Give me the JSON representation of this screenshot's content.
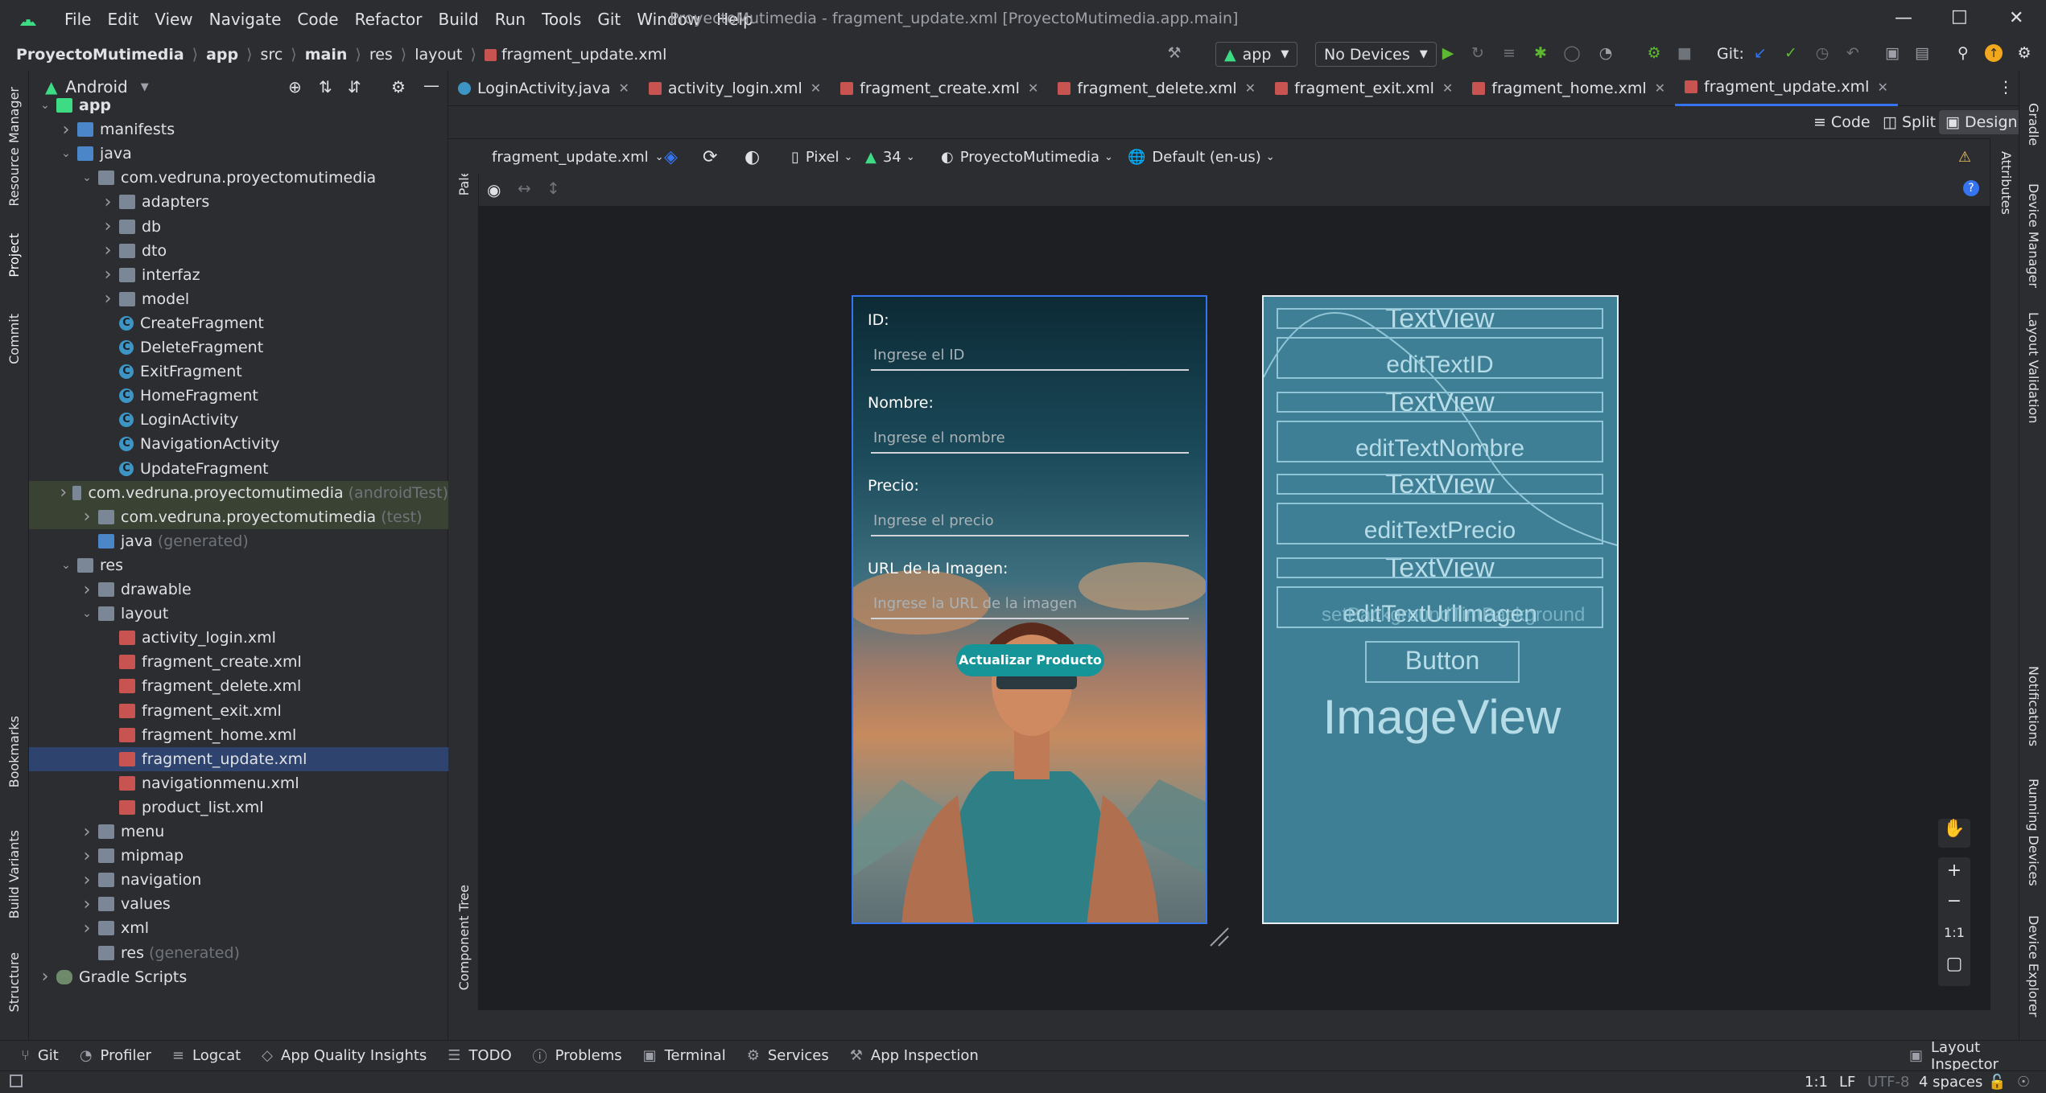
{
  "window": {
    "title": "ProyectoMutimedia - fragment_update.xml [ProyectoMutimedia.app.main]",
    "menu": [
      "File",
      "Edit",
      "View",
      "Navigate",
      "Code",
      "Refactor",
      "Build",
      "Run",
      "Tools",
      "Git",
      "Window",
      "Help"
    ]
  },
  "breadcrumb": [
    "ProyectoMutimedia",
    "app",
    "src",
    "main",
    "res",
    "layout",
    "fragment_update.xml"
  ],
  "toolbar": {
    "run_config": "app",
    "device": "No Devices",
    "git_label": "Git:"
  },
  "project": {
    "view_label": "Android",
    "tree": [
      {
        "label": "app",
        "level": 0,
        "type": "module",
        "bold": true,
        "open": true
      },
      {
        "label": "manifests",
        "level": 1,
        "type": "folder",
        "arrow": "closed"
      },
      {
        "label": "java",
        "level": 1,
        "type": "folder",
        "arrow": "open"
      },
      {
        "label": "com.vedruna.proyectomutimedia",
        "level": 2,
        "type": "folder",
        "arrow": "open"
      },
      {
        "label": "adapters",
        "level": 3,
        "type": "folder",
        "arrow": "closed"
      },
      {
        "label": "db",
        "level": 3,
        "type": "folder",
        "arrow": "closed"
      },
      {
        "label": "dto",
        "level": 3,
        "type": "folder",
        "arrow": "closed"
      },
      {
        "label": "interfaz",
        "level": 3,
        "type": "folder",
        "arrow": "closed"
      },
      {
        "label": "model",
        "level": 3,
        "type": "folder",
        "arrow": "closed"
      },
      {
        "label": "CreateFragment",
        "level": 3,
        "type": "class"
      },
      {
        "label": "DeleteFragment",
        "level": 3,
        "type": "class"
      },
      {
        "label": "ExitFragment",
        "level": 3,
        "type": "class"
      },
      {
        "label": "HomeFragment",
        "level": 3,
        "type": "class"
      },
      {
        "label": "LoginActivity",
        "level": 3,
        "type": "class"
      },
      {
        "label": "NavigationActivity",
        "level": 3,
        "type": "class"
      },
      {
        "label": "UpdateFragment",
        "level": 3,
        "type": "class"
      },
      {
        "label": "com.vedruna.proyectomutimedia",
        "suffix": "(androidTest)",
        "level": 2,
        "type": "folder",
        "arrow": "closed",
        "hl": true
      },
      {
        "label": "com.vedruna.proyectomutimedia",
        "suffix": "(test)",
        "level": 2,
        "type": "folder",
        "arrow": "closed",
        "hl": true
      },
      {
        "label": "java",
        "suffix": "(generated)",
        "level": 2,
        "type": "folder"
      },
      {
        "label": "res",
        "level": 1,
        "type": "folder",
        "arrow": "open"
      },
      {
        "label": "drawable",
        "level": 2,
        "type": "folder",
        "arrow": "closed"
      },
      {
        "label": "layout",
        "level": 2,
        "type": "folder",
        "arrow": "open"
      },
      {
        "label": "activity_login.xml",
        "level": 3,
        "type": "xml"
      },
      {
        "label": "fragment_create.xml",
        "level": 3,
        "type": "xml"
      },
      {
        "label": "fragment_delete.xml",
        "level": 3,
        "type": "xml"
      },
      {
        "label": "fragment_exit.xml",
        "level": 3,
        "type": "xml"
      },
      {
        "label": "fragment_home.xml",
        "level": 3,
        "type": "xml"
      },
      {
        "label": "fragment_update.xml",
        "level": 3,
        "type": "xml",
        "selected": true
      },
      {
        "label": "navigationmenu.xml",
        "level": 3,
        "type": "xml"
      },
      {
        "label": "product_list.xml",
        "level": 3,
        "type": "xml"
      },
      {
        "label": "menu",
        "level": 2,
        "type": "folder",
        "arrow": "closed"
      },
      {
        "label": "mipmap",
        "level": 2,
        "type": "folder",
        "arrow": "closed"
      },
      {
        "label": "navigation",
        "level": 2,
        "type": "folder",
        "arrow": "closed"
      },
      {
        "label": "values",
        "level": 2,
        "type": "folder",
        "arrow": "closed"
      },
      {
        "label": "xml",
        "level": 2,
        "type": "folder",
        "arrow": "closed"
      },
      {
        "label": "res",
        "suffix": "(generated)",
        "level": 2,
        "type": "folder"
      },
      {
        "label": "Gradle Scripts",
        "level": 0,
        "type": "gradle",
        "arrow": "closed"
      }
    ]
  },
  "left_strip": [
    "Resource Manager",
    "Project",
    "Commit",
    "Bookmarks",
    "Build Variants",
    "Structure"
  ],
  "right_strip": [
    "Gradle",
    "Device Manager",
    "Layout Validation",
    "Notifications",
    "Running Devices",
    "Device Explorer"
  ],
  "tabs": [
    {
      "label": "LoginActivity.java",
      "kind": "java"
    },
    {
      "label": "activity_login.xml",
      "kind": "xml"
    },
    {
      "label": "fragment_create.xml",
      "kind": "xml"
    },
    {
      "label": "fragment_delete.xml",
      "kind": "xml"
    },
    {
      "label": "fragment_exit.xml",
      "kind": "xml"
    },
    {
      "label": "fragment_home.xml",
      "kind": "xml"
    },
    {
      "label": "fragment_update.xml",
      "kind": "xml",
      "active": true
    }
  ],
  "view_modes": {
    "code": "Code",
    "split": "Split",
    "design": "Design"
  },
  "design_bar": {
    "file": "fragment_update.xml",
    "device": "Pixel",
    "api": "34",
    "theme": "ProyectoMutimedia",
    "locale": "Default (en-us)"
  },
  "side_labels": {
    "palette": "Palette",
    "component_tree": "Component Tree",
    "attributes": "Attributes"
  },
  "preview": {
    "id_label": "ID:",
    "id_hint": "Ingrese el ID",
    "name_label": "Nombre:",
    "name_hint": "Ingrese el nombre",
    "price_label": "Precio:",
    "price_hint": "Ingrese el precio",
    "url_label": "URL de la Imagen:",
    "url_hint": "Ingrese la URL de la imagen",
    "button": "Actualizar Producto"
  },
  "blueprint": {
    "textview": "TextView",
    "edit_id": "editTextID",
    "edit_name": "editTextNombre",
    "edit_price": "editTextPrecio",
    "edit_url": "editTextUrlImagen",
    "set_bg": "setBackgroundTintBackground",
    "button": "Button",
    "imageview": "ImageView"
  },
  "zoom": {
    "one_to_one": "1:1"
  },
  "bottom_tools": [
    "Git",
    "Profiler",
    "Logcat",
    "App Quality Insights",
    "TODO",
    "Problems",
    "Terminal",
    "Services",
    "App Inspection"
  ],
  "layout_inspector": "Layout Inspector",
  "status": {
    "pos": "1:1",
    "eol": "LF",
    "enc": "UTF-8",
    "indent": "4 spaces"
  },
  "colors": {
    "accent": "#3574f0",
    "button": "#169598",
    "blueprint": "#3f7f95"
  }
}
